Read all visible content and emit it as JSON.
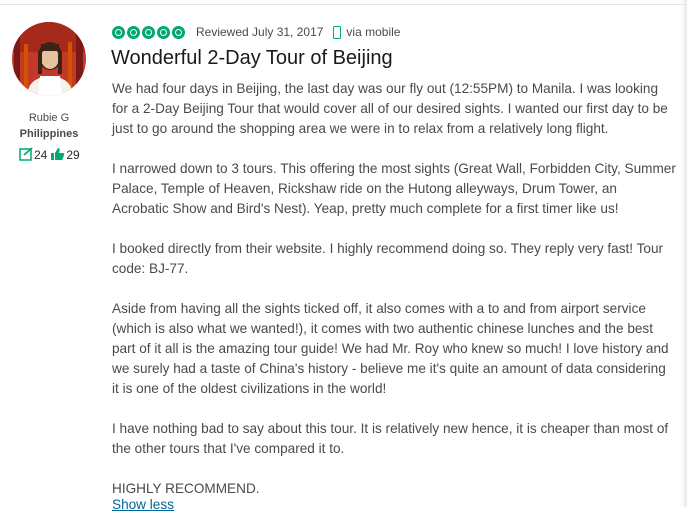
{
  "reviewer": {
    "name": "Rubie G",
    "location": "Philippines",
    "reviews_count": "24",
    "helpful_votes": "29"
  },
  "review": {
    "rating": 5,
    "rating_max": 5,
    "reviewed_date": "Reviewed July 31, 2017",
    "via": "via mobile",
    "title": "Wonderful 2-Day Tour of Beijing",
    "paragraphs": [
      "We had four days in Beijing, the last day was our fly out (12:55PM) to Manila. I was looking for a 2-Day Beijing Tour that would cover all of our desired sights. I wanted our first day to be just to go around the shopping area we were in to relax from a relatively long flight.",
      "I narrowed down to 3 tours. This offering the most sights (Great Wall, Forbidden City, Summer Palace, Temple of Heaven, Rickshaw ride on the Hutong alleyways, Drum Tower, an Acrobatic Show and Bird's Nest). Yeap, pretty much complete for a first timer like us!",
      "I booked directly from their website. I highly recommend doing so. They reply very fast! Tour code: BJ-77.",
      "Aside from having all the sights ticked off, it also comes with a to and from airport service (which is also what we wanted!), it comes with two authentic chinese lunches and the best part of it all is the amazing tour guide! We had Mr. Roy who knew so much! I love history and we surely had a taste of China's history - believe me it's quite an amount of data considering it is one of the oldest civilizations in the world!",
      "I have nothing bad to say about this tour. It is relatively new hence, it is cheaper than most of the other tours that I've compared it to.",
      "HIGHLY RECOMMEND."
    ],
    "show_less": "Show less"
  },
  "colors": {
    "accent": "#00aa6c",
    "link": "#006699",
    "text": "#4a4a4a"
  },
  "icons": {
    "reviews": "review-count-icon",
    "helpful": "thumbs-up-icon",
    "device": "mobile-phone-icon"
  }
}
